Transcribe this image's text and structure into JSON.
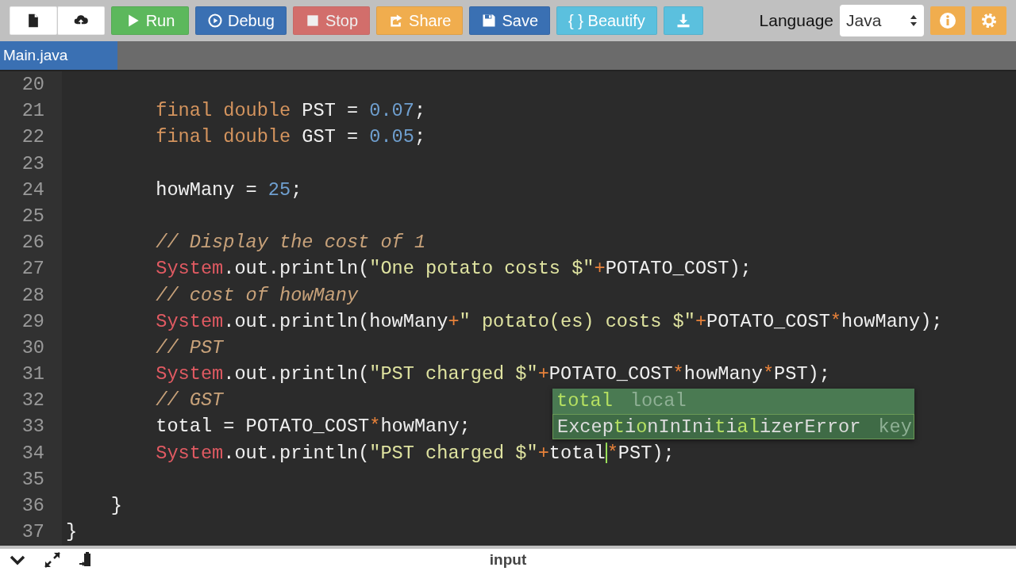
{
  "toolbar": {
    "buttons": [
      {
        "kind": "icon",
        "disabled": false
      },
      {
        "kind": "icon",
        "disabled": false
      },
      {
        "kind": "text",
        "label": "Run",
        "disabled": false
      },
      {
        "kind": "text",
        "label": "Debug",
        "disabled": false
      },
      {
        "kind": "text",
        "label": "Stop",
        "disabled": true
      },
      {
        "kind": "text",
        "label": "Share",
        "disabled": false
      },
      {
        "kind": "text",
        "label": "Save",
        "disabled": false
      },
      {
        "kind": "text",
        "label": "{ } Beautify",
        "disabled": false
      },
      {
        "kind": "icon",
        "disabled": false
      }
    ],
    "language_label": "Language",
    "language_value": "Java"
  },
  "tabs": [
    {
      "label": "Main.java",
      "selected": true
    }
  ],
  "editor": {
    "lines": [
      {
        "number": "20"
      },
      {
        "number": "21",
        "tokens": [
          {
            "kind": "keyword",
            "text": "        final double"
          },
          {
            "kind": "plain",
            "text": " PST = "
          },
          {
            "kind": "number",
            "text": "0.07"
          },
          {
            "kind": "plain",
            "text": ";"
          }
        ]
      },
      {
        "number": "22",
        "tokens": [
          {
            "kind": "keyword",
            "text": "        final double"
          },
          {
            "kind": "plain",
            "text": " GST = "
          },
          {
            "kind": "number",
            "text": "0.05"
          },
          {
            "kind": "plain",
            "text": ";"
          }
        ]
      },
      {
        "number": "23"
      },
      {
        "number": "24",
        "tokens": [
          {
            "kind": "plain",
            "text": "        howMany = "
          },
          {
            "kind": "number",
            "text": "25"
          },
          {
            "kind": "plain",
            "text": ";"
          }
        ]
      },
      {
        "number": "25"
      },
      {
        "number": "26",
        "tokens": [
          {
            "kind": "comment",
            "text": "        // Display the cost of 1"
          }
        ]
      },
      {
        "number": "27",
        "tokens": [
          {
            "kind": "class",
            "text": "        System"
          },
          {
            "kind": "plain",
            "text": ".out.println("
          },
          {
            "kind": "string",
            "text": "\"One potato costs $\""
          },
          {
            "kind": "operator",
            "text": "+"
          },
          {
            "kind": "plain",
            "text": "POTATO_COST);"
          }
        ]
      },
      {
        "number": "28",
        "tokens": [
          {
            "kind": "comment",
            "text": "        // cost of howMany"
          }
        ]
      },
      {
        "number": "29",
        "tokens": [
          {
            "kind": "class",
            "text": "        System"
          },
          {
            "kind": "plain",
            "text": ".out.println(howMany"
          },
          {
            "kind": "operator",
            "text": "+"
          },
          {
            "kind": "string",
            "text": "\" potato(es) costs $\""
          },
          {
            "kind": "operator",
            "text": "+"
          },
          {
            "kind": "plain",
            "text": "POTATO_COST"
          },
          {
            "kind": "operator",
            "text": "*"
          },
          {
            "kind": "plain",
            "text": "howMany);"
          }
        ]
      },
      {
        "number": "30",
        "tokens": [
          {
            "kind": "comment",
            "text": "        // PST"
          }
        ]
      },
      {
        "number": "31",
        "tokens": [
          {
            "kind": "class",
            "text": "        System"
          },
          {
            "kind": "plain",
            "text": ".out.println("
          },
          {
            "kind": "string",
            "text": "\"PST charged $\""
          },
          {
            "kind": "operator",
            "text": "+"
          },
          {
            "kind": "plain",
            "text": "POTATO_COST"
          },
          {
            "kind": "operator",
            "text": "*"
          },
          {
            "kind": "plain",
            "text": "howMany"
          },
          {
            "kind": "operator",
            "text": "*"
          },
          {
            "kind": "plain",
            "text": "PST);"
          }
        ]
      },
      {
        "number": "32",
        "tokens": [
          {
            "kind": "comment",
            "text": "        // GST"
          }
        ]
      },
      {
        "number": "33",
        "tokens": [
          {
            "kind": "plain",
            "text": "        total = POTATO_COST"
          },
          {
            "kind": "operator",
            "text": "*"
          },
          {
            "kind": "plain",
            "text": "howMany;"
          }
        ]
      },
      {
        "number": "34",
        "tokens": [
          {
            "kind": "class",
            "text": "        System"
          },
          {
            "kind": "plain",
            "text": ".out.println("
          },
          {
            "kind": "string",
            "text": "\"PST charged $\""
          },
          {
            "kind": "operator",
            "text": "+"
          },
          {
            "kind": "plain",
            "text": "total",
            "caret": true
          },
          {
            "kind": "operator",
            "text": "*"
          },
          {
            "kind": "plain",
            "text": "PST);"
          }
        ]
      },
      {
        "number": "35"
      },
      {
        "number": "36",
        "tokens": [
          {
            "kind": "plain",
            "text": "    }"
          }
        ]
      },
      {
        "number": "37",
        "tokens": [
          {
            "kind": "plain",
            "text": "}"
          }
        ]
      }
    ]
  },
  "autocomplete": {
    "items": [
      {
        "selected": true,
        "segments": [
          {
            "text": "total",
            "match": true
          }
        ],
        "meta": "local"
      },
      {
        "selected": false,
        "segments": [
          {
            "text": "Excep",
            "match": false
          },
          {
            "text": "t",
            "match": true
          },
          {
            "text": "i",
            "match": false
          },
          {
            "text": "o",
            "match": true
          },
          {
            "text": "nInIni",
            "match": false
          },
          {
            "text": "t",
            "match": true
          },
          {
            "text": "i",
            "match": false
          },
          {
            "text": "a",
            "match": true
          },
          {
            "text": "l",
            "match": true
          },
          {
            "text": "izerError",
            "match": false
          }
        ],
        "meta": "key"
      }
    ]
  },
  "bottom_bar": {
    "label": "input"
  }
}
